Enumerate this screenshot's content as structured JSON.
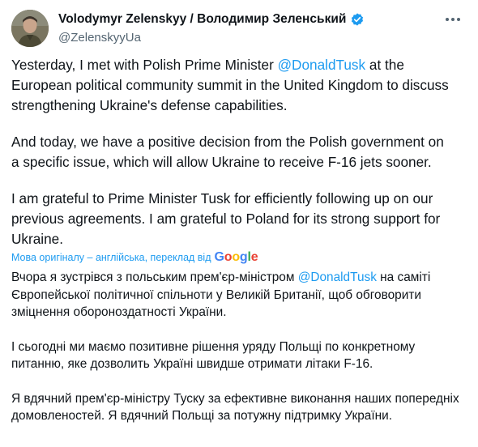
{
  "author": {
    "display_name": "Volodymyr Zelenskyy / Володимир Зеленський",
    "handle": "@ZelenskyyUa",
    "verified_icon": "verified-badge-icon",
    "verified_color": "#1d9bf0"
  },
  "menu_icon": "more-horizontal-icon",
  "original": {
    "p1_before": "Yesterday, I met with Polish Prime Minister ",
    "p1_mention": "@DonaldTusk",
    "p1_after": " at the European political community summit in the United Kingdom to discuss strengthening Ukraine's defense capabilities.",
    "p2": "And today, we have a positive decision from the Polish government on a specific issue, which will allow Ukraine to receive F-16 jets sooner.",
    "p3": "I am grateful to Prime Minister Tusk for efficiently following up on our previous agreements. I am grateful to Poland for its strong support for Ukraine."
  },
  "translation": {
    "label": "Мова оригіналу – англійська, переклад від",
    "provider_logo": "Google",
    "p1_before": "Вчора я зустрівся з польським прем'єр-міністром ",
    "p1_mention": "@DonaldTusk",
    "p1_after": " на саміті Європейської політичної спільноти у Великій Британії, щоб обговорити зміцнення обороноздатності України.",
    "p2": "І сьогодні ми маємо позитивне рішення уряду Польщі по конкретному питанню, яке дозволить Україні швидше отримати літаки F-16.",
    "p3": "Я вдячний прем'єр-міністру Туску за ефективне виконання наших попередніх домовленостей. Я вдячний Польщі за потужну підтримку України."
  },
  "colors": {
    "link": "#1d9bf0",
    "text": "#0f1419",
    "secondary": "#536471"
  }
}
